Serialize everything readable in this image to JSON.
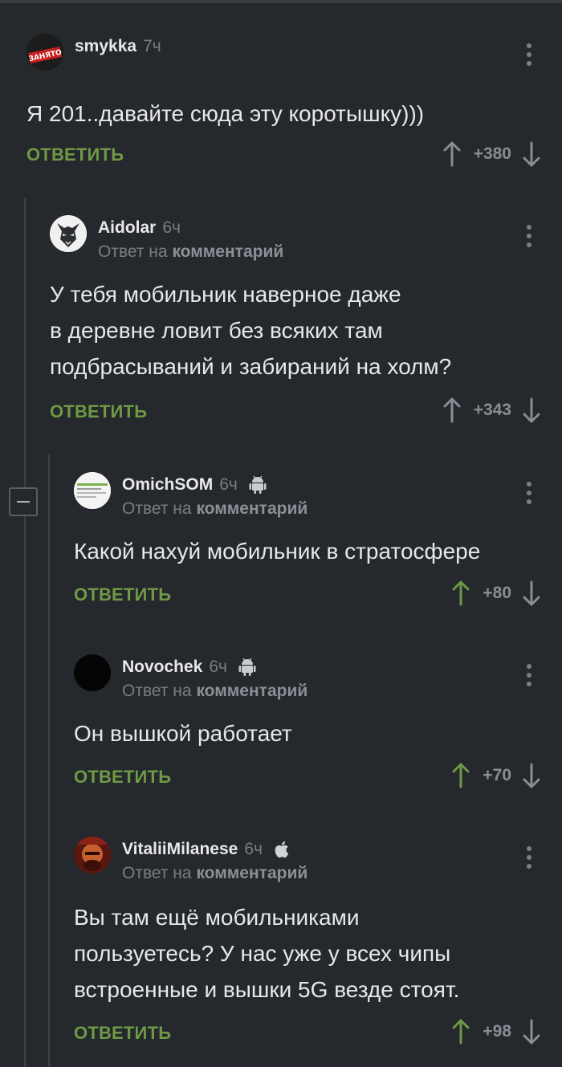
{
  "actions": {
    "reply_label": "ОТВЕТИТЬ",
    "reply_to_prefix": "Ответ на",
    "reply_to_link": "комментарий"
  },
  "colors": {
    "background": "#25282c",
    "reply": "#6f9a45",
    "upvoted": "#6f9a45",
    "neutral": "#8a8e94"
  },
  "comments": [
    {
      "user": "smykka",
      "time": "7ч",
      "is_reply": false,
      "text": "Я 201..давайте сюда эту коротышку)))",
      "rating": "+380",
      "upvoted": false,
      "platform": null,
      "avatar_label": "ЗАНЯТО"
    },
    {
      "user": "Aidolar",
      "time": "6ч",
      "is_reply": true,
      "text_lines": [
        "У тебя мобильник наверное даже",
        "в деревне ловит без всяких там",
        "подбрасываний и забираний на холм?"
      ],
      "rating": "+343",
      "upvoted": false,
      "platform": null
    },
    {
      "user": "OmichSOM",
      "time": "6ч",
      "is_reply": true,
      "text": "Какой нахуй мобильник в стратосфере",
      "rating": "+80",
      "upvoted": true,
      "platform": "android-icon"
    },
    {
      "user": "Novochek",
      "time": "6ч",
      "is_reply": true,
      "text": "Он вышкой работает",
      "rating": "+70",
      "upvoted": true,
      "platform": "android-icon"
    },
    {
      "user": "VitaliiMilanese",
      "time": "6ч",
      "is_reply": true,
      "text_lines": [
        "Вы там ещё мобильниками",
        "пользуетесь? У нас уже у всех чипы",
        "встроенные и вышки 5G везде стоят."
      ],
      "rating": "+98",
      "upvoted": true,
      "platform": "apple-icon"
    }
  ]
}
